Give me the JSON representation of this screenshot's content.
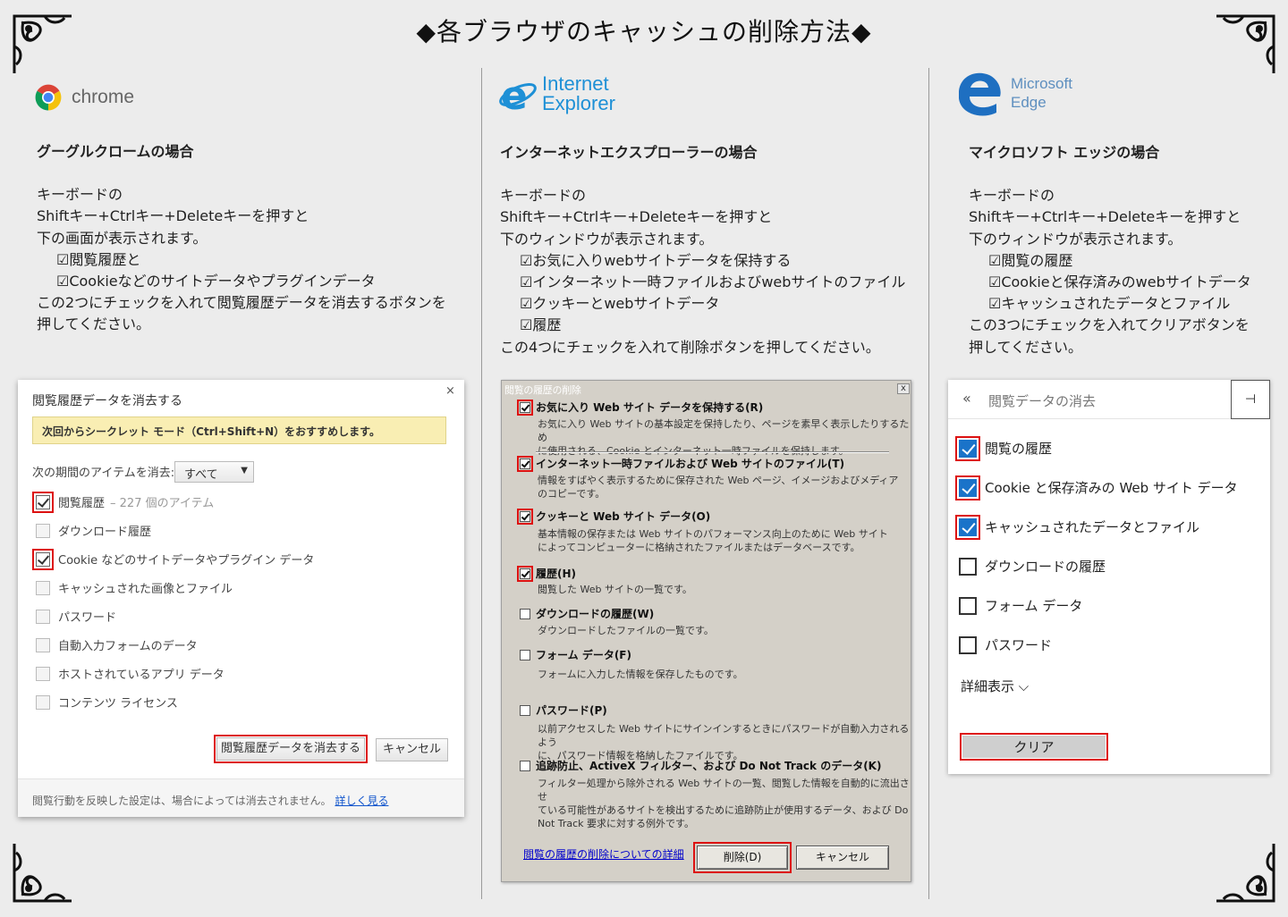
{
  "page": {
    "title": "◆各ブラウザのキャッシュの削除方法◆"
  },
  "columns": [
    {
      "logo_text": "chrome",
      "heading": "グーグルクロームの場合",
      "lines": [
        "キーボードの",
        "Shiftキー+Ctrlキー+Deleteキーを押すと",
        "下の画面が表示されます。"
      ],
      "items": [
        "☑閲覧履歴と",
        "☑Cookieなどのサイトデータやプラグインデータ"
      ],
      "after": [
        "この2つにチェックを入れて閲覧履歴データを消去するボタンを",
        "押してください。"
      ]
    },
    {
      "logo_text_1": "Internet",
      "logo_text_2": "Explorer",
      "heading": "インターネットエクスプローラーの場合",
      "lines": [
        "キーボードの",
        "Shiftキー+Ctrlキー+Deleteキーを押すと",
        "下のウィンドウが表示されます。"
      ],
      "items": [
        "☑お気に入りwebサイトデータを保持する",
        "☑インターネット一時ファイルおよびwebサイトのファイル",
        "☑クッキーとwebサイトデータ",
        "☑履歴"
      ],
      "after": [
        "この4つにチェックを入れて削除ボタンを押してください。"
      ]
    },
    {
      "logo_text_1": "Microsoft",
      "logo_text_2": "Edge",
      "heading": "マイクロソフト エッジの場合",
      "lines": [
        "キーボードの",
        "Shiftキー+Ctrlキー+Deleteキーを押すと",
        "下のウィンドウが表示されます。"
      ],
      "items": [
        "☑閲覧の履歴",
        "☑Cookieと保存済みのwebサイトデータ",
        "☑キャッシュされたデータとファイル"
      ],
      "after": [
        "この3つにチェックを入れてクリアボタンを",
        "押してください。"
      ]
    }
  ],
  "chrome_dialog": {
    "title": "閲覧履歴データを消去する",
    "close": "×",
    "notice": "次回からシークレット モード（Ctrl+Shift+N）をおすすめします。",
    "period_label": "次の期間のアイテムを消去:",
    "period_value": "すべて",
    "options": [
      {
        "label": "閲覧履歴",
        "extra": "– 227 個のアイテム",
        "checked": true
      },
      {
        "label": "ダウンロード履歴",
        "checked": false
      },
      {
        "label": "Cookie などのサイトデータやプラグイン データ",
        "checked": true
      },
      {
        "label": "キャッシュされた画像とファイル",
        "checked": false
      },
      {
        "label": "パスワード",
        "checked": false
      },
      {
        "label": "自動入力フォームのデータ",
        "checked": false
      },
      {
        "label": "ホストされているアプリ データ",
        "checked": false
      },
      {
        "label": "コンテンツ ライセンス",
        "checked": false
      }
    ],
    "clear_button": "閲覧履歴データを消去する",
    "cancel_button": "キャンセル",
    "footer_text": "閲覧行動を反映した設定は、場合によっては消去されません。",
    "footer_link": "詳しく見る"
  },
  "ie_dialog": {
    "title": "閲覧の履歴の削除",
    "close": "x",
    "options": [
      {
        "label": "お気に入り Web サイト データを保持する(R)",
        "desc": [
          "お気に入り Web サイトの基本設定を保持したり、ページを素早く表示したりするため",
          "に使用される、Cookie とインターネット一時ファイルを保持します。"
        ],
        "checked": true
      },
      {
        "label": "インターネット一時ファイルおよび Web サイトのファイル(T)",
        "desc": [
          "情報をすばやく表示するために保存された Web ページ、イメージおよびメディア",
          "のコピーです。"
        ],
        "checked": true
      },
      {
        "label": "クッキーと Web サイト データ(O)",
        "desc": [
          "基本情報の保存または Web サイトのパフォーマンス向上のために Web サイト",
          "によってコンピューターに格納されたファイルまたはデータベースです。"
        ],
        "checked": true
      },
      {
        "label": "履歴(H)",
        "desc": [
          "閲覧した Web サイトの一覧です。"
        ],
        "checked": true
      },
      {
        "label": "ダウンロードの履歴(W)",
        "desc": [
          "ダウンロードしたファイルの一覧です。"
        ],
        "checked": false
      },
      {
        "label": "フォーム データ(F)",
        "desc": [
          "フォームに入力した情報を保存したものです。"
        ],
        "checked": false
      },
      {
        "label": "パスワード(P)",
        "desc": [
          "以前アクセスした Web サイトにサインインするときにパスワードが自動入力されるよう",
          "に、パスワード情報を格納したファイルです。"
        ],
        "checked": false
      },
      {
        "label": "追跡防止、ActiveX フィルター、および Do Not Track のデータ(K)",
        "desc": [
          "フィルター処理から除外される Web サイトの一覧、閲覧した情報を自動的に流出させ",
          "ている可能性があるサイトを検出するために追跡防止が使用するデータ、および Do",
          "Not Track 要求に対する例外です。"
        ],
        "checked": false
      }
    ],
    "link": "閲覧の履歴の削除についての詳細",
    "delete_button": "削除(D)",
    "cancel_button": "キャンセル"
  },
  "edge_dialog": {
    "back": "«",
    "title": "閲覧データの消去",
    "pin": "⊣",
    "options": [
      {
        "label": "閲覧の履歴",
        "checked": true
      },
      {
        "label": "Cookie と保存済みの Web サイト データ",
        "checked": true
      },
      {
        "label": "キャッシュされたデータとファイル",
        "checked": true
      },
      {
        "label": "ダウンロードの履歴",
        "checked": false
      },
      {
        "label": "フォーム データ",
        "checked": false
      },
      {
        "label": "パスワード",
        "checked": false
      }
    ],
    "more": "詳細表示 ⌵",
    "clear_button": "クリア"
  },
  "colors": {
    "background": "#ececec",
    "highlight_red": "#dd1111",
    "edge_blue": "#1a73c9",
    "ie_blue": "#1e90d6",
    "tip_yellow": "#f9eeb3"
  },
  "icons": [
    "chrome-logo-icon",
    "ie-logo-icon",
    "edge-logo-icon",
    "ornament-corner-icon"
  ]
}
